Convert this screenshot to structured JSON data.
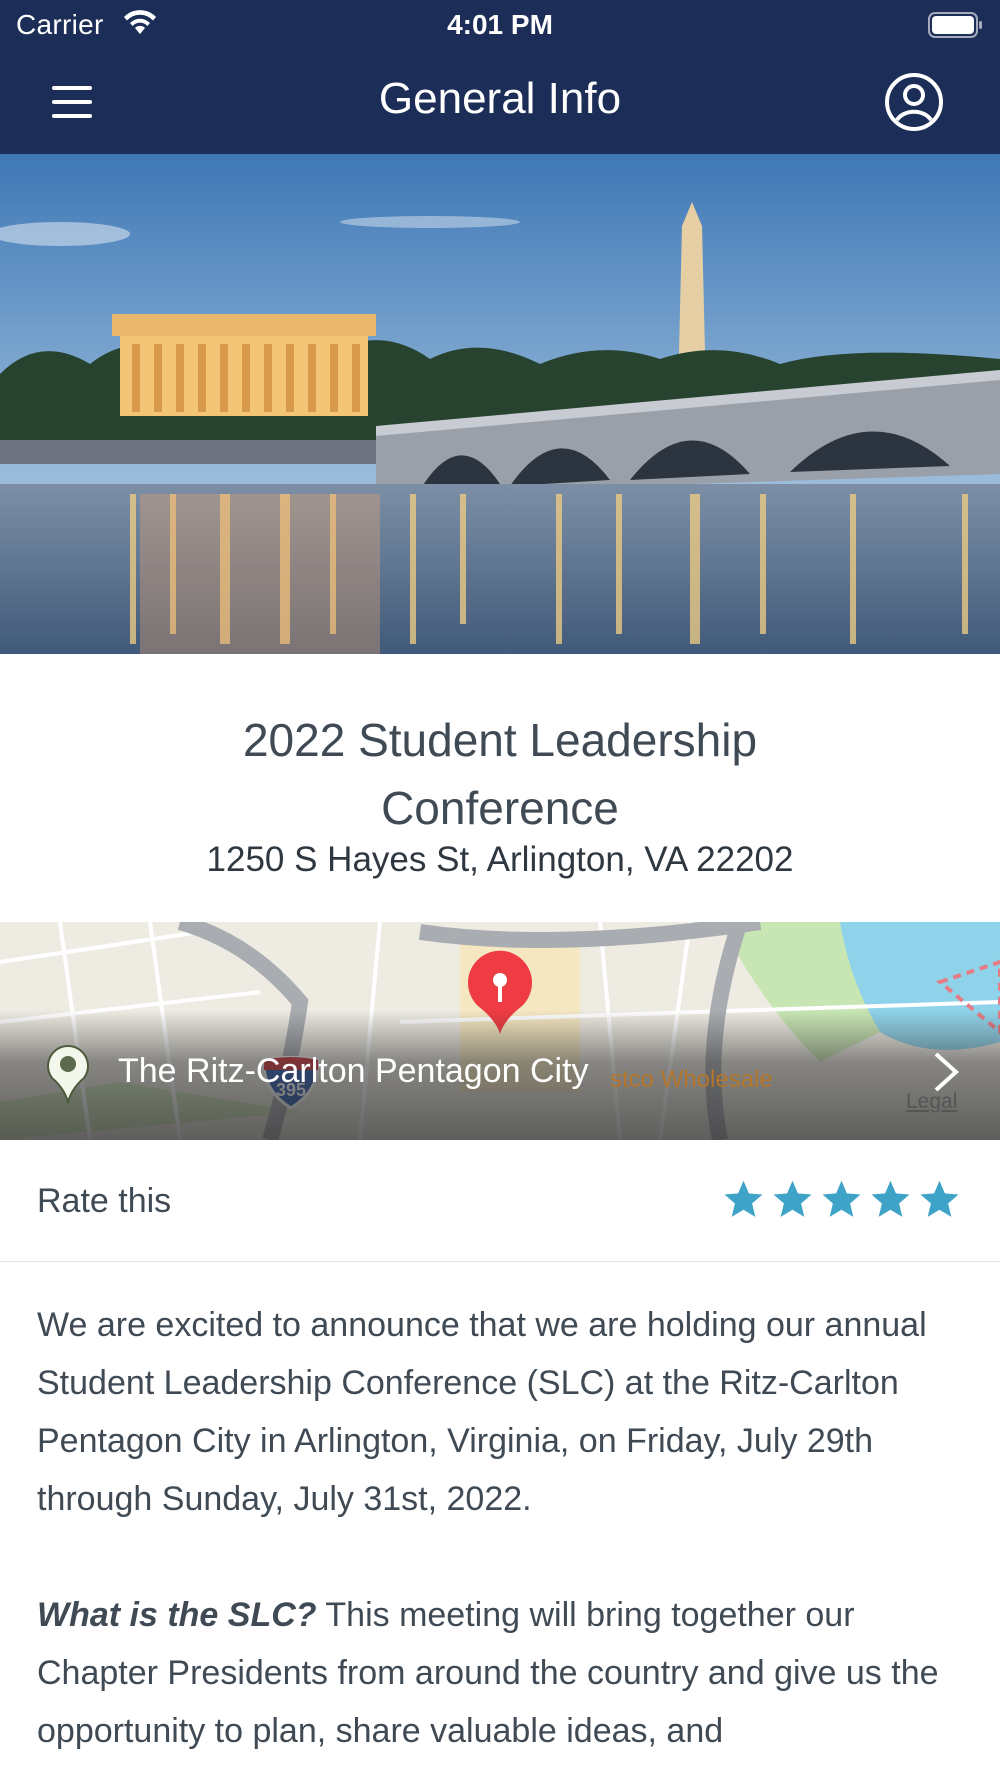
{
  "status_bar": {
    "carrier": "Carrier",
    "time": "4:01 PM"
  },
  "nav": {
    "title": "General Info"
  },
  "hero": {
    "image": "Washington DC Lincoln Memorial and Arlington Memorial Bridge at dusk"
  },
  "event": {
    "title": "2022 Student Leadership Conference",
    "address": "1250 S Hayes St, Arlington, VA 22202"
  },
  "map": {
    "venue": "The Ritz-Carlton Pentagon City",
    "poi": "stco Wholesale",
    "highway_shield": "395",
    "legal": "Legal"
  },
  "rating": {
    "label": "Rate this",
    "stars": 5,
    "color": "#3fa3c8"
  },
  "description": {
    "paragraph1": "We are excited to announce that we are holding our annual Student Leadership Conference (SLC) at the Ritz-Carlton Pentagon City in Arlington, Virginia, on Friday, July 29th through Sunday, July 31st, 2022.",
    "paragraph2_lead": "What is the SLC?",
    "paragraph2_body": " This meeting will bring together our Chapter Presidents from around the country and give us the opportunity to plan, share valuable ideas, and"
  },
  "colors": {
    "nav_bg": "#1c2e57",
    "accent": "#3fa3c8",
    "marker": "#ef3b44"
  }
}
